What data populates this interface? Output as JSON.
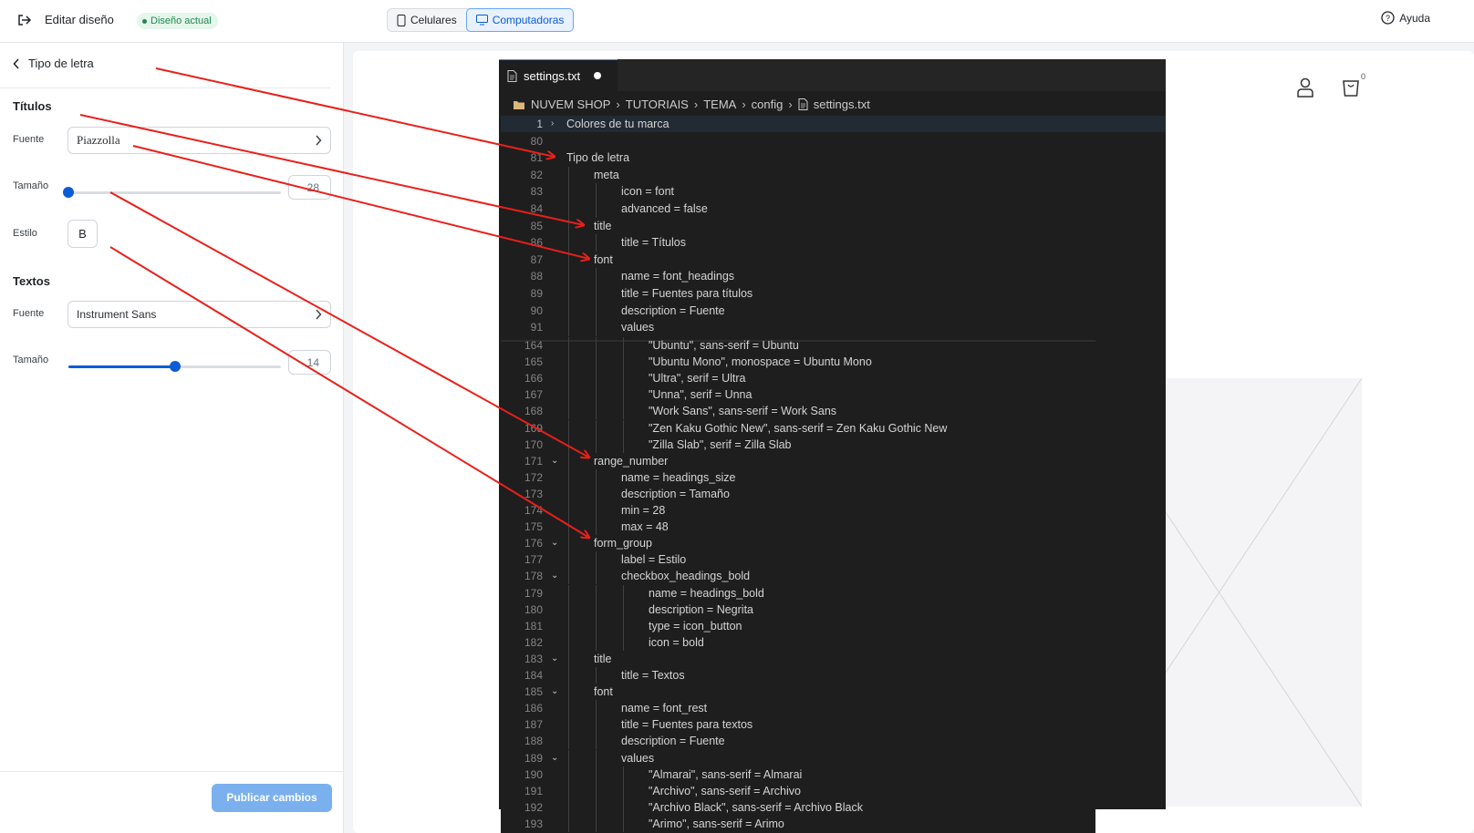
{
  "topbar": {
    "exit_icon": "exit-icon",
    "editar_label": "Editar diseño",
    "badge_label": "Diseño actual",
    "device_mobile": "Celulares",
    "device_desktop": "Computadoras",
    "help_label": "Ayuda"
  },
  "panel": {
    "back_label": "Tipo de letra",
    "titulos": {
      "title": "Títulos",
      "fuente_label": "Fuente",
      "fuente_value": "Piazzolla",
      "tamano_label": "Tamaño",
      "tamano_value": "28",
      "tamano_fraction": 0.0,
      "estilo_label": "Estilo",
      "estilo_button": "B"
    },
    "textos": {
      "title": "Textos",
      "fuente_label": "Fuente",
      "fuente_value": "Instrument Sans",
      "tamano_label": "Tamaño",
      "tamano_value": "14",
      "tamano_fraction": 0.5
    },
    "publish_label": "Publicar cambios"
  },
  "preview": {
    "cart_count": "0"
  },
  "editor": {
    "tab_title": "settings.txt",
    "breadcrumb": [
      "NUVEM SHOP",
      "TUTORIAIS",
      "TEMA",
      "config",
      "settings.txt"
    ],
    "lines_top": [
      {
        "n": "1",
        "indent": 0,
        "text": "Colores de tu marca",
        "fold": "closed"
      },
      {
        "n": "80",
        "indent": 0,
        "text": ""
      },
      {
        "n": "81",
        "indent": 0,
        "text": "Tipo de letra"
      },
      {
        "n": "82",
        "indent": 1,
        "text": "meta"
      },
      {
        "n": "83",
        "indent": 2,
        "text": "icon = font"
      },
      {
        "n": "84",
        "indent": 2,
        "text": "advanced = false"
      },
      {
        "n": "85",
        "indent": 1,
        "text": "title"
      },
      {
        "n": "86",
        "indent": 2,
        "text": "title = Títulos"
      },
      {
        "n": "87",
        "indent": 1,
        "text": "font"
      },
      {
        "n": "88",
        "indent": 2,
        "text": "name = font_headings"
      },
      {
        "n": "89",
        "indent": 2,
        "text": "title = Fuentes para títulos"
      },
      {
        "n": "90",
        "indent": 2,
        "text": "description = Fuente"
      },
      {
        "n": "91",
        "indent": 2,
        "text": "values"
      }
    ],
    "lines_bottom": [
      {
        "n": "164",
        "indent": 3,
        "text": "\"Ubuntu\", sans-serif = Ubuntu"
      },
      {
        "n": "165",
        "indent": 3,
        "text": "\"Ubuntu Mono\", monospace = Ubuntu Mono"
      },
      {
        "n": "166",
        "indent": 3,
        "text": "\"Ultra\", serif = Ultra"
      },
      {
        "n": "167",
        "indent": 3,
        "text": "\"Unna\", serif = Unna"
      },
      {
        "n": "168",
        "indent": 3,
        "text": "\"Work Sans\", sans-serif = Work Sans"
      },
      {
        "n": "169",
        "indent": 3,
        "text": "\"Zen Kaku Gothic New\", sans-serif = Zen Kaku Gothic New"
      },
      {
        "n": "170",
        "indent": 3,
        "text": "\"Zilla Slab\", serif = Zilla Slab"
      },
      {
        "n": "171",
        "indent": 1,
        "text": "range_number",
        "fold": "open"
      },
      {
        "n": "172",
        "indent": 2,
        "text": "name = headings_size"
      },
      {
        "n": "173",
        "indent": 2,
        "text": "description = Tamaño"
      },
      {
        "n": "174",
        "indent": 2,
        "text": "min = 28"
      },
      {
        "n": "175",
        "indent": 2,
        "text": "max = 48"
      },
      {
        "n": "176",
        "indent": 1,
        "text": "form_group",
        "fold": "open"
      },
      {
        "n": "177",
        "indent": 2,
        "text": "label = Estilo"
      },
      {
        "n": "178",
        "indent": 2,
        "text": "checkbox_headings_bold",
        "fold": "open"
      },
      {
        "n": "179",
        "indent": 3,
        "text": "name = headings_bold"
      },
      {
        "n": "180",
        "indent": 3,
        "text": "description = Negrita"
      },
      {
        "n": "181",
        "indent": 3,
        "text": "type = icon_button"
      },
      {
        "n": "182",
        "indent": 3,
        "text": "icon = bold"
      },
      {
        "n": "183",
        "indent": 1,
        "text": "title",
        "fold": "open"
      },
      {
        "n": "184",
        "indent": 2,
        "text": "title = Textos"
      },
      {
        "n": "185",
        "indent": 1,
        "text": "font",
        "fold": "open"
      },
      {
        "n": "186",
        "indent": 2,
        "text": "name = font_rest"
      },
      {
        "n": "187",
        "indent": 2,
        "text": "title = Fuentes para textos"
      },
      {
        "n": "188",
        "indent": 2,
        "text": "description = Fuente"
      },
      {
        "n": "189",
        "indent": 2,
        "text": "values",
        "fold": "open"
      },
      {
        "n": "190",
        "indent": 3,
        "text": "\"Almarai\", sans-serif = Almarai"
      },
      {
        "n": "191",
        "indent": 3,
        "text": "\"Archivo\", sans-serif = Archivo"
      },
      {
        "n": "192",
        "indent": 3,
        "text": "\"Archivo Black\", sans-serif = Archivo Black"
      },
      {
        "n": "193",
        "indent": 3,
        "text": "\"Arimo\", sans-serif = Arimo"
      }
    ]
  },
  "colors": {
    "accent": "#0b5cd5",
    "arrow": "#e8201b",
    "editor_bg": "#1e1e1e"
  }
}
